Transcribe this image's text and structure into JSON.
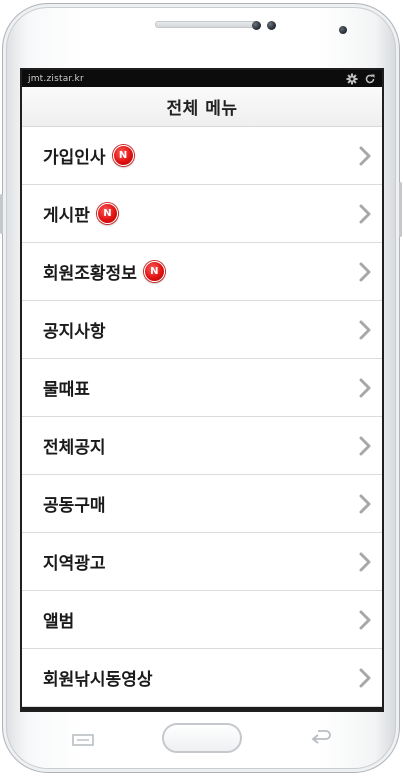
{
  "status_bar": {
    "url": "jmt.zistar.kr",
    "icons": [
      "gear-icon",
      "refresh-icon"
    ]
  },
  "header": {
    "title": "전체 메뉴"
  },
  "menu": {
    "items": [
      {
        "label": "가입인사",
        "badge": "N"
      },
      {
        "label": "게시판",
        "badge": "N"
      },
      {
        "label": "회원조황정보",
        "badge": "N"
      },
      {
        "label": "공지사항",
        "badge": ""
      },
      {
        "label": "물때표",
        "badge": ""
      },
      {
        "label": "전체공지",
        "badge": ""
      },
      {
        "label": "공동구매",
        "badge": ""
      },
      {
        "label": "지역광고",
        "badge": ""
      },
      {
        "label": "앨범",
        "badge": ""
      },
      {
        "label": "회원낚시동영상",
        "badge": ""
      }
    ],
    "chevron_icon": "chevron-right-icon"
  },
  "colors": {
    "badge": "#e01212",
    "status_bar_bg": "#0c0c0c",
    "title_bar_bg": "#f2f2f2",
    "divider": "#dcdcdc"
  }
}
